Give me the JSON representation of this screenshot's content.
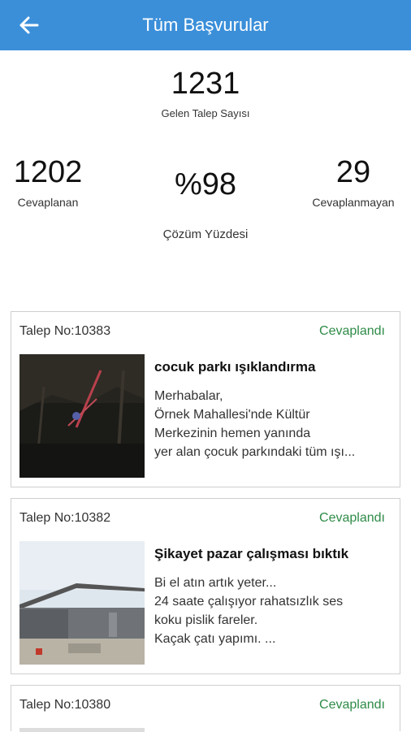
{
  "header": {
    "title": "Tüm Başvurular"
  },
  "stats": {
    "total": {
      "value": "1231",
      "label": "Gelen Talep Sayısı"
    },
    "answered": {
      "value": "1202",
      "label": "Cevaplanan"
    },
    "percent": {
      "value": "%98",
      "label": "Çözüm Yüzdesi"
    },
    "unanswered": {
      "value": "29",
      "label": "Cevaplanmayan"
    }
  },
  "requests": [
    {
      "no": "Talep No:10383",
      "status": "Cevaplandı",
      "title": "cocuk parkı ışıklandırma",
      "lines": [
        "Merhabalar,",
        "Örnek Mahallesi'nde Kültür",
        "Merkezinin hemen yanında",
        "yer alan çocuk parkındaki tüm ışı..."
      ]
    },
    {
      "no": "Talep No:10382",
      "status": "Cevaplandı",
      "title": "Şikayet pazar çalışması bıktık",
      "lines": [
        "Bi el atın artık yeter...",
        "24 saate çalışıyor rahatsızlık ses",
        "koku pislik fareler.",
        "Kaçak çatı yapımı. ..."
      ]
    },
    {
      "no": "Talep No:10380",
      "status": "Cevaplandı"
    }
  ],
  "colors": {
    "appbar": "#3b8fd9",
    "status": "#2e8b47"
  },
  "icons": {
    "back": "arrow-left-icon"
  }
}
